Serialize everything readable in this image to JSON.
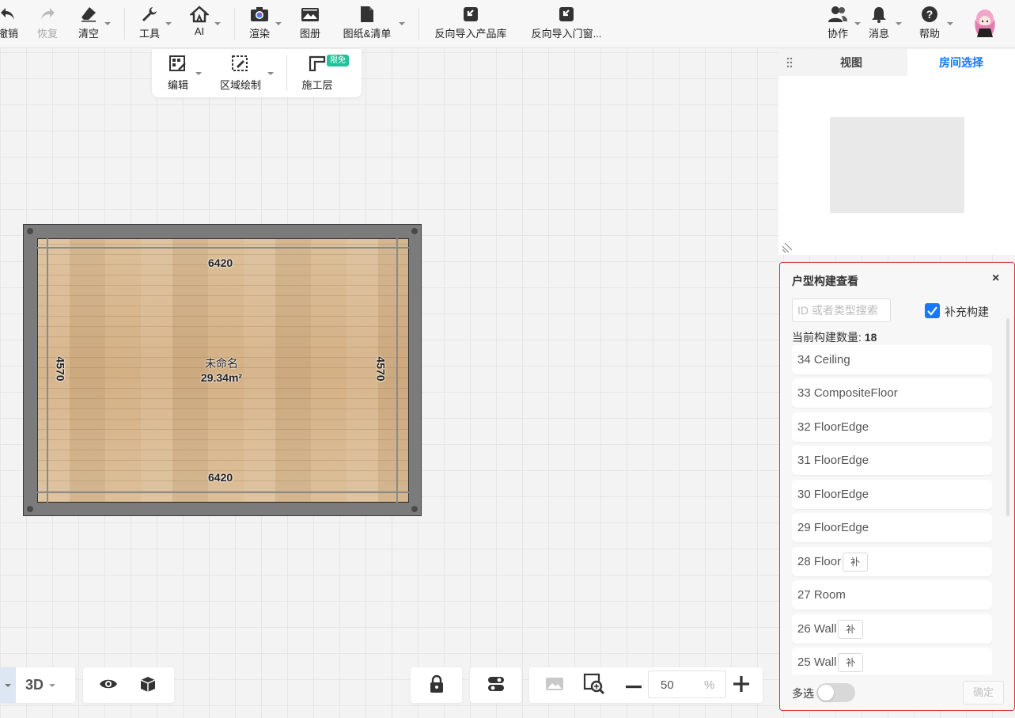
{
  "toolbar": {
    "undo": "撤销",
    "redo": "恢复",
    "clear": "清空",
    "tools": "工具",
    "ai": "AI",
    "render": "渲染",
    "album": "图册",
    "drawings": "图纸&清单",
    "reverse_product": "反向导入产品库",
    "reverse_door": "反向导入门窗...",
    "collab": "协作",
    "messages": "消息",
    "help": "帮助"
  },
  "subbar": {
    "edit": "编辑",
    "region_draw": "区域绘制",
    "construction_layer": "施工层",
    "free_badge": "限免"
  },
  "floorplan": {
    "top_dim": "6420",
    "bottom_dim": "6420",
    "left_dim": "4570",
    "right_dim": "4570",
    "room_name": "未命名",
    "room_area": "29.34m²"
  },
  "right_panel": {
    "tab_view": "视图",
    "tab_room": "房间选择",
    "active_tab": "房间选择",
    "accent": "#1677ff"
  },
  "structure_viewer": {
    "title": "户型构建查看",
    "close": "×",
    "search_placeholder": "ID 或者类型搜索",
    "search_value": "",
    "supplement_label": "补充构建",
    "supplement_checked": true,
    "count_label": "当前构建数量:",
    "count_value": "18",
    "items": [
      {
        "label": "34 Ceiling",
        "tag": ""
      },
      {
        "label": "33 CompositeFloor",
        "tag": ""
      },
      {
        "label": "32 FloorEdge",
        "tag": ""
      },
      {
        "label": "31 FloorEdge",
        "tag": ""
      },
      {
        "label": "30 FloorEdge",
        "tag": ""
      },
      {
        "label": "29 FloorEdge",
        "tag": ""
      },
      {
        "label": "28 Floor",
        "tag": "补"
      },
      {
        "label": "27 Room",
        "tag": ""
      },
      {
        "label": "26 Wall",
        "tag": "补"
      },
      {
        "label": "25 Wall",
        "tag": "补"
      }
    ],
    "multi_select": "多选",
    "multi_select_on": false,
    "confirm": "确定",
    "border_color": "#d83a3a"
  },
  "bottom": {
    "view_mode": "3D",
    "zoom_value": "50",
    "zoom_unit": "%"
  }
}
